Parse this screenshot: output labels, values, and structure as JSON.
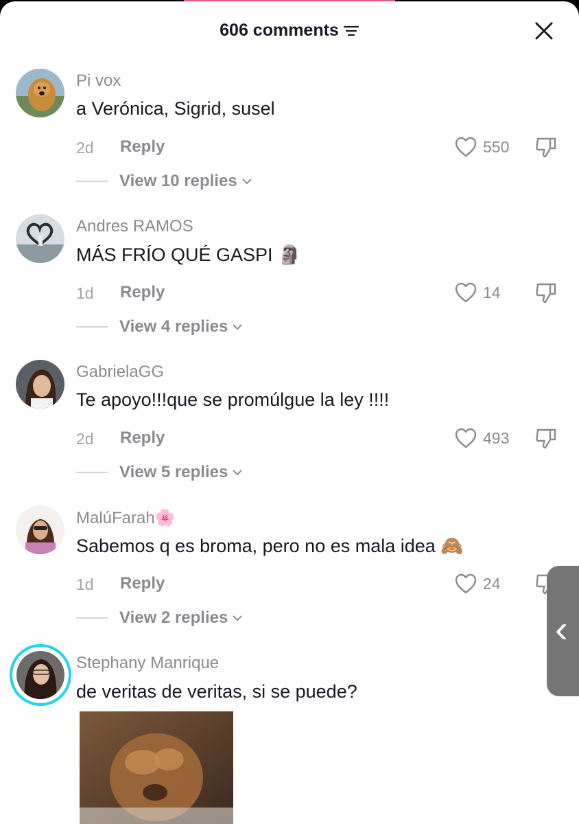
{
  "header": {
    "title": "606 comments",
    "filter_icon": "filter-icon",
    "close_icon": "close-icon"
  },
  "reply_label": "Reply",
  "comments": [
    {
      "username": "Pi vox",
      "text": "a Verónica, Sigrid, susel",
      "time": "2d",
      "likes": "550",
      "view_replies": "View 10 replies"
    },
    {
      "username": "Andres RAMOS",
      "text": "MÁS FRÍO QUÉ GASPI 🗿",
      "time": "1d",
      "likes": "14",
      "view_replies": "View 4 replies"
    },
    {
      "username": "GabrielaGG",
      "text": "Te apoyo!!!que se promúlgue la ley !!!!",
      "time": "2d",
      "likes": "493",
      "view_replies": "View 5 replies"
    },
    {
      "username": "MalúFarah🌸",
      "text": "Sabemos q es broma, pero no es mala idea 🙈",
      "time": "1d",
      "likes": "24",
      "view_replies": "View 2 replies"
    },
    {
      "username": "Stephany Manrique",
      "text": "de veritas de veritas, si se puede?"
    }
  ],
  "side_handle": "‹",
  "colors": {
    "text": "#161823",
    "muted": "#8a8b91",
    "background": "#ffffff",
    "story_ring": "#20d5ec"
  }
}
